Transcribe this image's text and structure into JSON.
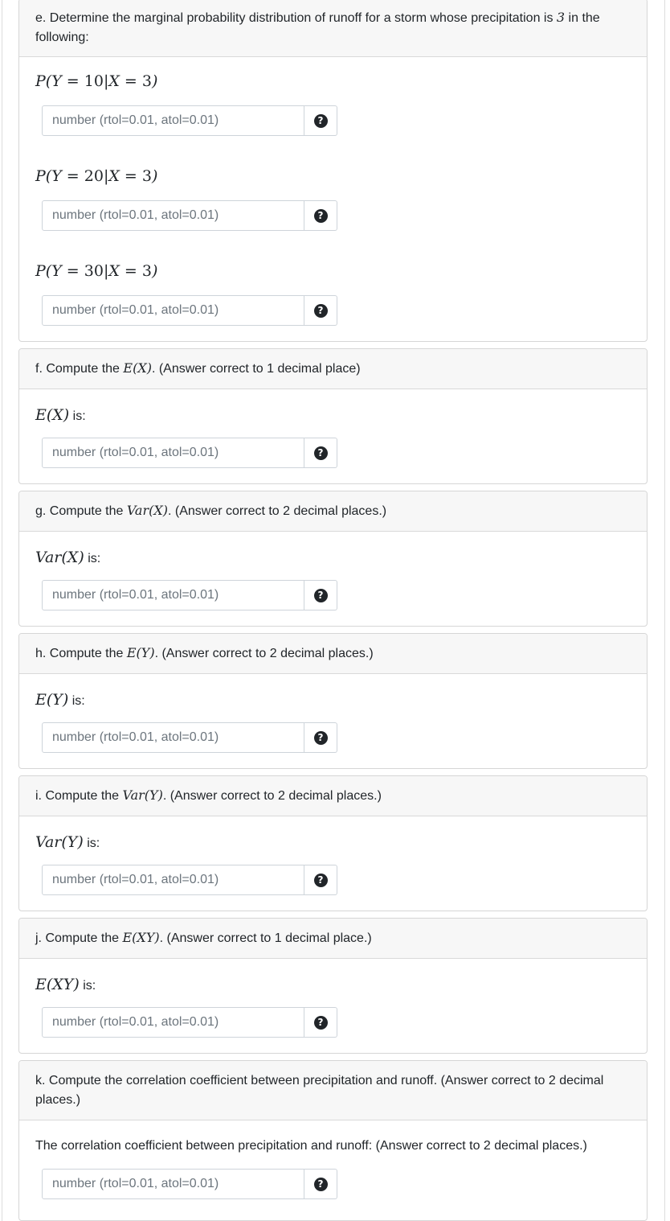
{
  "placeholder": "number (rtol=0.01, atol=0.01)",
  "help_icon_glyph": "?",
  "e": {
    "header_before": "e. Determine the marginal probability distribution of runoff for a storm whose precipitation is ",
    "header_num": "3",
    "header_after": " in the following:",
    "items": [
      {
        "y": "10",
        "x": "3"
      },
      {
        "y": "20",
        "x": "3"
      },
      {
        "y": "30",
        "x": "3"
      }
    ]
  },
  "f": {
    "header_before": "f. Compute the ",
    "header_math": "E(X)",
    "header_after": ". (Answer correct to 1 decimal place)",
    "label_math": "E(X)",
    "label_suffix": " is:"
  },
  "g": {
    "header_before": "g. Compute the ",
    "header_math": "Var(X)",
    "header_after": ". (Answer correct to 2 decimal places.)",
    "label_math": "Var(X)",
    "label_suffix": " is:"
  },
  "h": {
    "header_before": "h. Compute the ",
    "header_math": "E(Y)",
    "header_after": ". (Answer correct to 2 decimal places.)",
    "label_math": "E(Y)",
    "label_suffix": " is:"
  },
  "i": {
    "header_before": "i. Compute the ",
    "header_math": "Var(Y)",
    "header_after": ". (Answer correct to 2 decimal places.)",
    "label_math": "Var(Y)",
    "label_suffix": " is:"
  },
  "j": {
    "header_before": "j. Compute the ",
    "header_math": "E(XY)",
    "header_after": ". (Answer correct to 1 decimal place.)",
    "label_math": "E(XY)",
    "label_suffix": " is:"
  },
  "k": {
    "header": "k. Compute the correlation coefficient between precipitation and runoff. (Answer correct to 2 decimal places.)",
    "label": "The correlation coefficient between precipitation and runoff: (Answer correct to 2 decimal places.)"
  }
}
